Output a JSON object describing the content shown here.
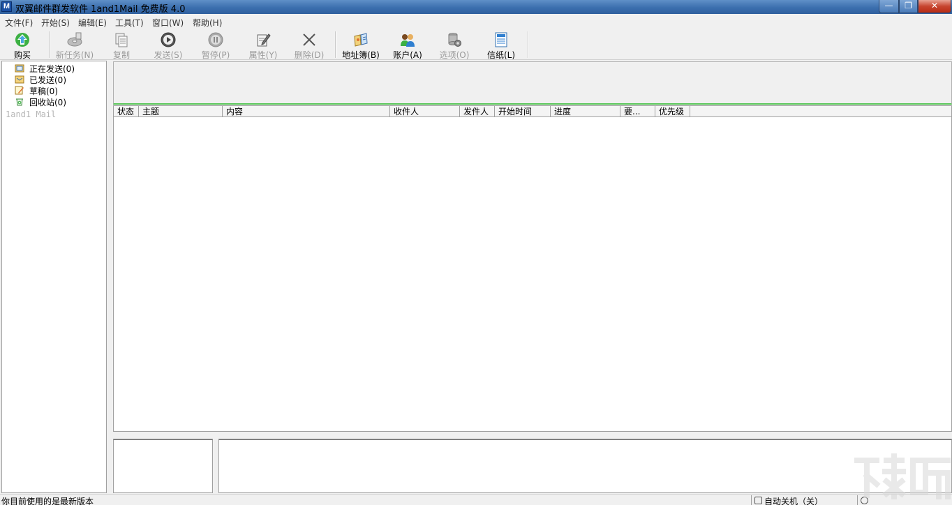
{
  "window": {
    "title": "双翼邮件群发软件 1and1Mail 免费版 4.0",
    "controls": {
      "minimize": "—",
      "maximize": "❐",
      "close": "✕"
    }
  },
  "menu": [
    "文件(F)",
    "开始(S)",
    "编辑(E)",
    "工具(T)",
    "窗口(W)",
    "帮助(H)"
  ],
  "toolbar": {
    "buy": "购买",
    "new_task": "新任务(N)",
    "copy": "复制",
    "send": "发送(S)",
    "pause": "暂停(P)",
    "properties": "属性(Y)",
    "delete": "删除(D)",
    "address_book": "地址簿(B)",
    "accounts": "账户(A)",
    "options": "选项(O)",
    "stationery": "信纸(L)"
  },
  "tree": {
    "items": [
      {
        "label": "正在发送(0)",
        "icon": "sending-folder-icon"
      },
      {
        "label": "已发送(0)",
        "icon": "sent-folder-icon"
      },
      {
        "label": "草稿(0)",
        "icon": "draft-icon"
      },
      {
        "label": "回收站(0)",
        "icon": "recycle-bin-icon"
      }
    ],
    "brand": "1and1 Mail"
  },
  "task_list": {
    "columns": [
      "状态",
      "主题",
      "内容",
      "收件人",
      "发件人",
      "开始时间",
      "进度",
      "要...",
      "优先级"
    ],
    "rows": []
  },
  "status": {
    "message": "你目前使用的是最新版本",
    "auto_shutdown": "自动关机（关）"
  },
  "colors": {
    "title_bar": "#3b6fae",
    "info_panel_border": "#58c658",
    "close_button": "#c7452f"
  }
}
